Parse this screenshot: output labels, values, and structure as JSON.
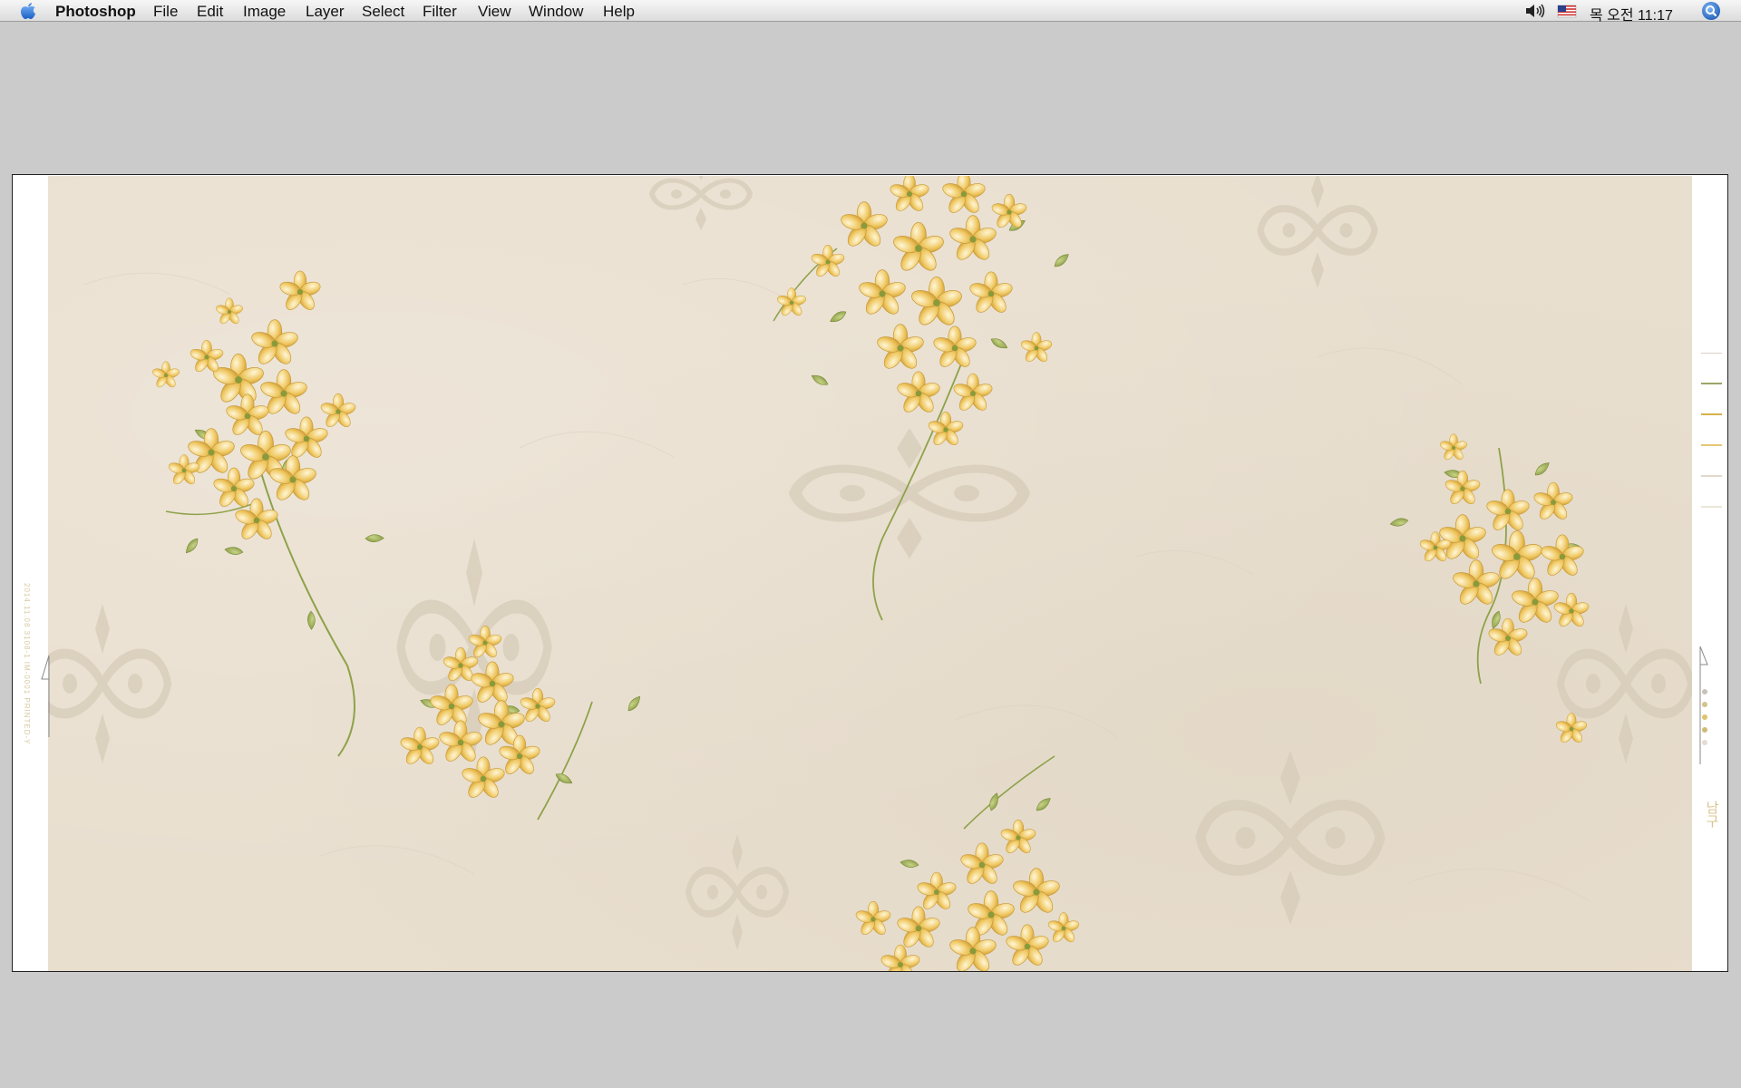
{
  "menubar": {
    "app_name": "Photoshop",
    "items": [
      "File",
      "Edit",
      "Image",
      "Layer",
      "Select",
      "Filter",
      "View",
      "Window",
      "Help"
    ],
    "clock": "목 오전 11:17"
  },
  "document": {
    "selvage_left": "2014.11.08 3108-1 IM-0001 PRINTED-Y",
    "selvage_right": "남구"
  },
  "colors": {
    "menubar": "#e8e8e8",
    "workspace": "#cbcbcb",
    "wallpaper": "#e9dfcf",
    "flower_gold": "#e5b43f",
    "leaf_green": "#8ea24a",
    "damask": "#d9cfbf"
  }
}
